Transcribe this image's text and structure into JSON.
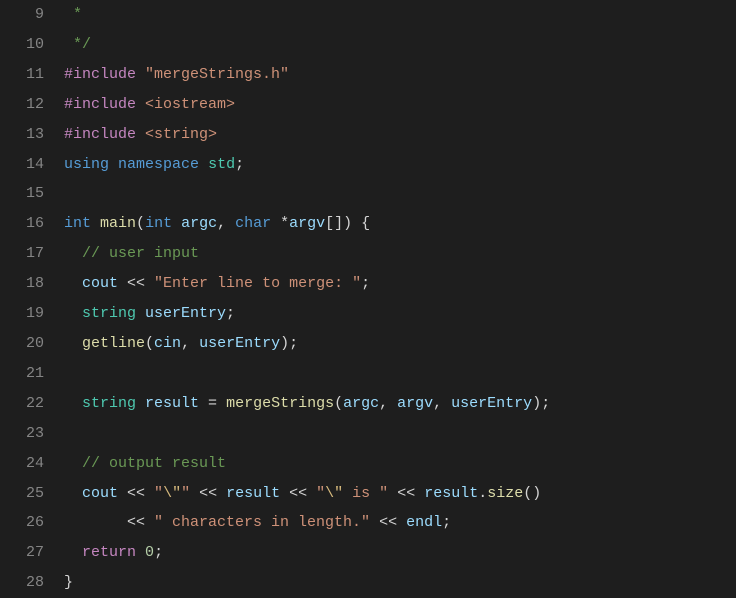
{
  "startLine": 9,
  "lines": [
    {
      "tokens": [
        {
          "t": " ",
          "c": ""
        },
        {
          "t": "*",
          "c": "comment"
        }
      ]
    },
    {
      "tokens": [
        {
          "t": " ",
          "c": ""
        },
        {
          "t": "*/",
          "c": "comment"
        }
      ]
    },
    {
      "tokens": [
        {
          "t": "#include",
          "c": "keyword-ctrl"
        },
        {
          "t": " ",
          "c": ""
        },
        {
          "t": "\"mergeStrings.h\"",
          "c": "string"
        }
      ]
    },
    {
      "tokens": [
        {
          "t": "#include",
          "c": "keyword-ctrl"
        },
        {
          "t": " ",
          "c": ""
        },
        {
          "t": "<iostream>",
          "c": "string"
        }
      ]
    },
    {
      "tokens": [
        {
          "t": "#include",
          "c": "keyword-ctrl"
        },
        {
          "t": " ",
          "c": ""
        },
        {
          "t": "<string>",
          "c": "string"
        }
      ]
    },
    {
      "tokens": [
        {
          "t": "using",
          "c": "keyword-type"
        },
        {
          "t": " ",
          "c": ""
        },
        {
          "t": "namespace",
          "c": "keyword-type"
        },
        {
          "t": " ",
          "c": ""
        },
        {
          "t": "std",
          "c": "namespace"
        },
        {
          "t": ";",
          "c": "punct"
        }
      ]
    },
    {
      "tokens": [
        {
          "t": "",
          "c": ""
        }
      ]
    },
    {
      "tokens": [
        {
          "t": "int",
          "c": "keyword-type"
        },
        {
          "t": " ",
          "c": ""
        },
        {
          "t": "main",
          "c": "function"
        },
        {
          "t": "(",
          "c": "punct"
        },
        {
          "t": "int",
          "c": "keyword-type"
        },
        {
          "t": " ",
          "c": ""
        },
        {
          "t": "argc",
          "c": "variable"
        },
        {
          "t": ", ",
          "c": "punct"
        },
        {
          "t": "char",
          "c": "keyword-type"
        },
        {
          "t": " *",
          "c": "operator"
        },
        {
          "t": "argv",
          "c": "variable"
        },
        {
          "t": "[]) {",
          "c": "punct"
        }
      ]
    },
    {
      "tokens": [
        {
          "t": "  ",
          "c": ""
        },
        {
          "t": "// user input",
          "c": "comment"
        }
      ]
    },
    {
      "tokens": [
        {
          "t": "  ",
          "c": ""
        },
        {
          "t": "cout",
          "c": "variable"
        },
        {
          "t": " << ",
          "c": "operator"
        },
        {
          "t": "\"Enter line to merge: \"",
          "c": "string"
        },
        {
          "t": ";",
          "c": "punct"
        }
      ]
    },
    {
      "tokens": [
        {
          "t": "  ",
          "c": ""
        },
        {
          "t": "string ",
          "c": "namespace"
        },
        {
          "t": "userEntry",
          "c": "variable"
        },
        {
          "t": ";",
          "c": "punct"
        }
      ]
    },
    {
      "tokens": [
        {
          "t": "  ",
          "c": ""
        },
        {
          "t": "getline",
          "c": "function"
        },
        {
          "t": "(",
          "c": "punct"
        },
        {
          "t": "cin",
          "c": "variable"
        },
        {
          "t": ", ",
          "c": "punct"
        },
        {
          "t": "userEntry",
          "c": "variable"
        },
        {
          "t": ");",
          "c": "punct"
        }
      ]
    },
    {
      "tokens": [
        {
          "t": "",
          "c": ""
        }
      ]
    },
    {
      "tokens": [
        {
          "t": "  ",
          "c": ""
        },
        {
          "t": "string ",
          "c": "namespace"
        },
        {
          "t": "result",
          "c": "variable"
        },
        {
          "t": " = ",
          "c": "operator"
        },
        {
          "t": "mergeStrings",
          "c": "function"
        },
        {
          "t": "(",
          "c": "punct"
        },
        {
          "t": "argc",
          "c": "variable"
        },
        {
          "t": ", ",
          "c": "punct"
        },
        {
          "t": "argv",
          "c": "variable"
        },
        {
          "t": ", ",
          "c": "punct"
        },
        {
          "t": "userEntry",
          "c": "variable"
        },
        {
          "t": ");",
          "c": "punct"
        }
      ]
    },
    {
      "tokens": [
        {
          "t": "",
          "c": ""
        }
      ]
    },
    {
      "tokens": [
        {
          "t": "  ",
          "c": ""
        },
        {
          "t": "// output result",
          "c": "comment"
        }
      ]
    },
    {
      "tokens": [
        {
          "t": "  ",
          "c": ""
        },
        {
          "t": "cout",
          "c": "variable"
        },
        {
          "t": " << ",
          "c": "operator"
        },
        {
          "t": "\"",
          "c": "string"
        },
        {
          "t": "\\\"",
          "c": "escape"
        },
        {
          "t": "\"",
          "c": "string"
        },
        {
          "t": " << ",
          "c": "operator"
        },
        {
          "t": "result",
          "c": "variable"
        },
        {
          "t": " << ",
          "c": "operator"
        },
        {
          "t": "\"",
          "c": "string"
        },
        {
          "t": "\\\"",
          "c": "escape"
        },
        {
          "t": " is \"",
          "c": "string"
        },
        {
          "t": " << ",
          "c": "operator"
        },
        {
          "t": "result",
          "c": "variable"
        },
        {
          "t": ".",
          "c": "punct"
        },
        {
          "t": "size",
          "c": "function"
        },
        {
          "t": "()",
          "c": "punct"
        }
      ]
    },
    {
      "tokens": [
        {
          "t": "       << ",
          "c": "operator"
        },
        {
          "t": "\" characters in length.\"",
          "c": "string"
        },
        {
          "t": " << ",
          "c": "operator"
        },
        {
          "t": "endl",
          "c": "variable"
        },
        {
          "t": ";",
          "c": "punct"
        }
      ]
    },
    {
      "tokens": [
        {
          "t": "  ",
          "c": ""
        },
        {
          "t": "return",
          "c": "keyword-ctrl"
        },
        {
          "t": " ",
          "c": ""
        },
        {
          "t": "0",
          "c": "number"
        },
        {
          "t": ";",
          "c": "punct"
        }
      ]
    },
    {
      "tokens": [
        {
          "t": "}",
          "c": "punct"
        }
      ]
    }
  ]
}
